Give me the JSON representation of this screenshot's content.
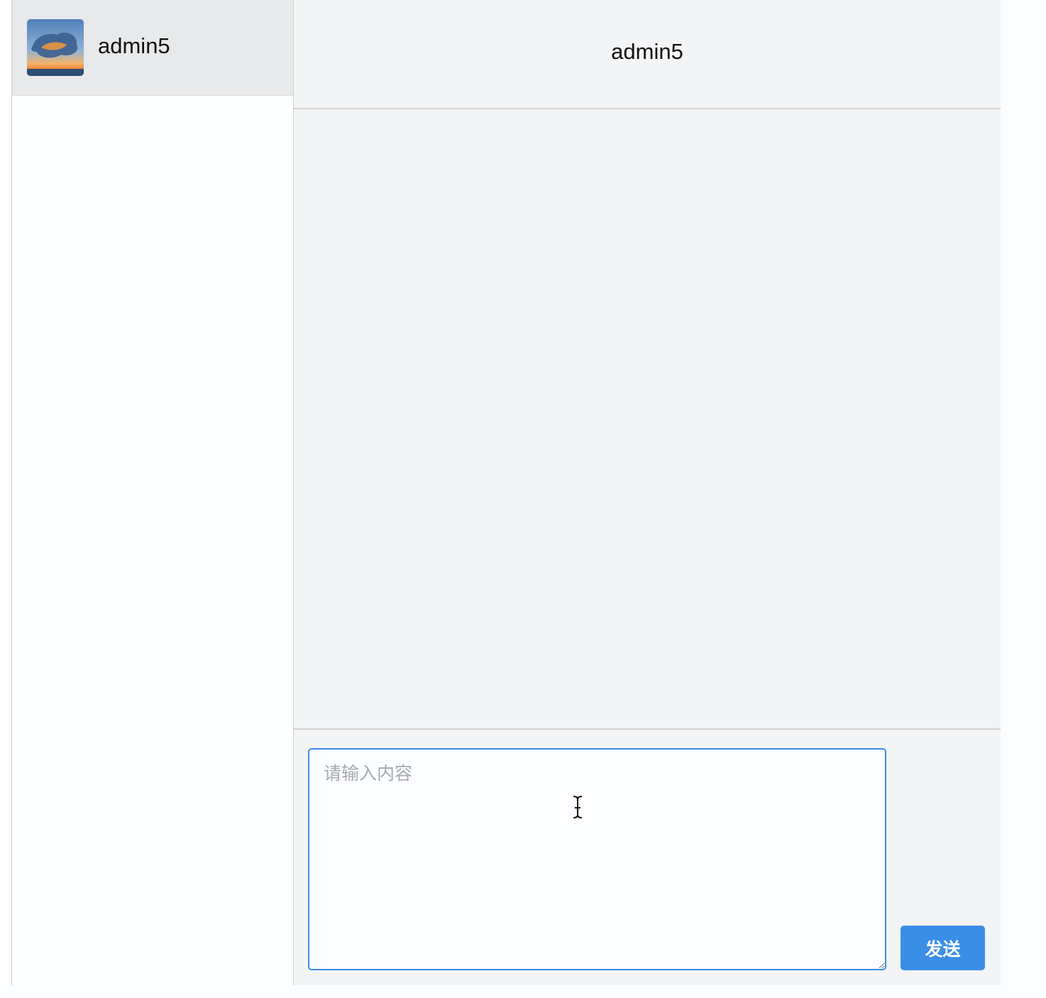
{
  "sidebar": {
    "contacts": [
      {
        "name": "admin5",
        "avatar": "sky-avatar-image",
        "selected": true
      }
    ]
  },
  "chat": {
    "title": "admin5",
    "messages": []
  },
  "composer": {
    "input_value": "",
    "input_placeholder": "请输入内容",
    "send_label": "发送",
    "accent_color": "#3a8ee6"
  }
}
